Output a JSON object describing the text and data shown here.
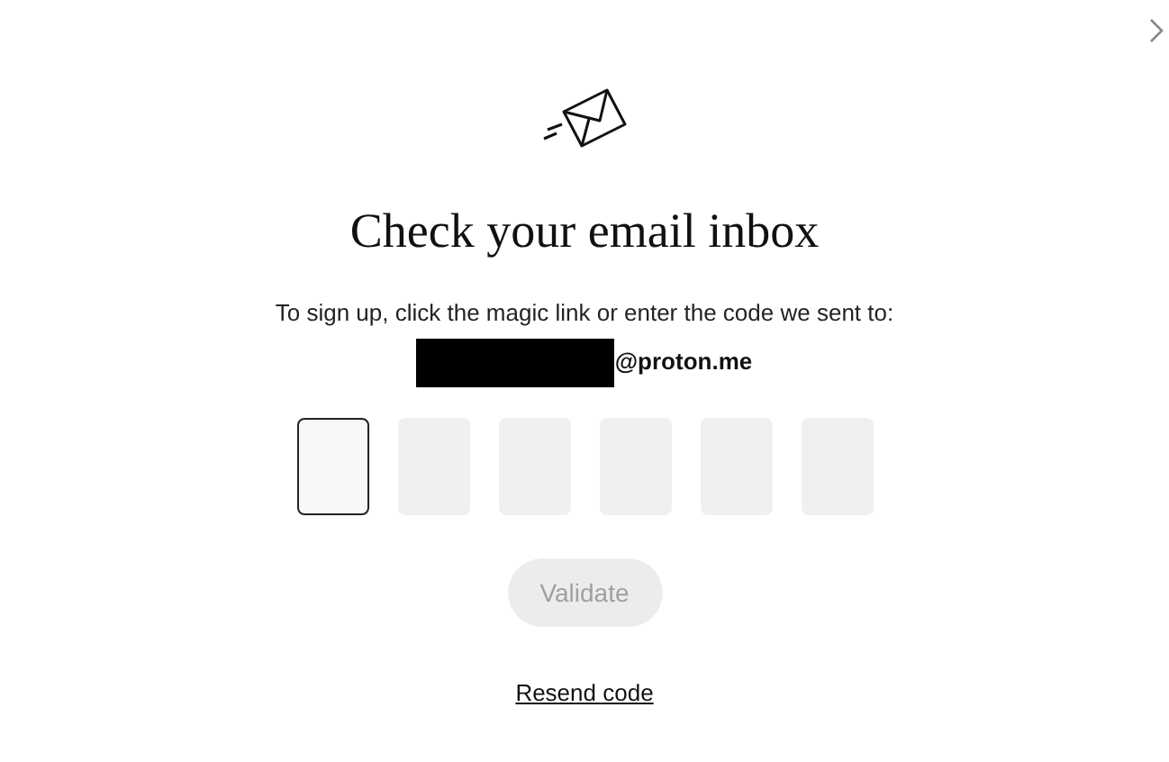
{
  "title": "Check your email inbox",
  "instruction": "To sign up, click the magic link or enter the code we sent to:",
  "email": {
    "redacted": true,
    "domain": "@proton.me"
  },
  "code_inputs": [
    {
      "focused": true
    },
    {
      "focused": false
    },
    {
      "focused": false
    },
    {
      "focused": false
    },
    {
      "focused": false
    },
    {
      "focused": false
    }
  ],
  "validate_button": {
    "label": "Validate",
    "disabled": true
  },
  "resend_link": "Resend code"
}
